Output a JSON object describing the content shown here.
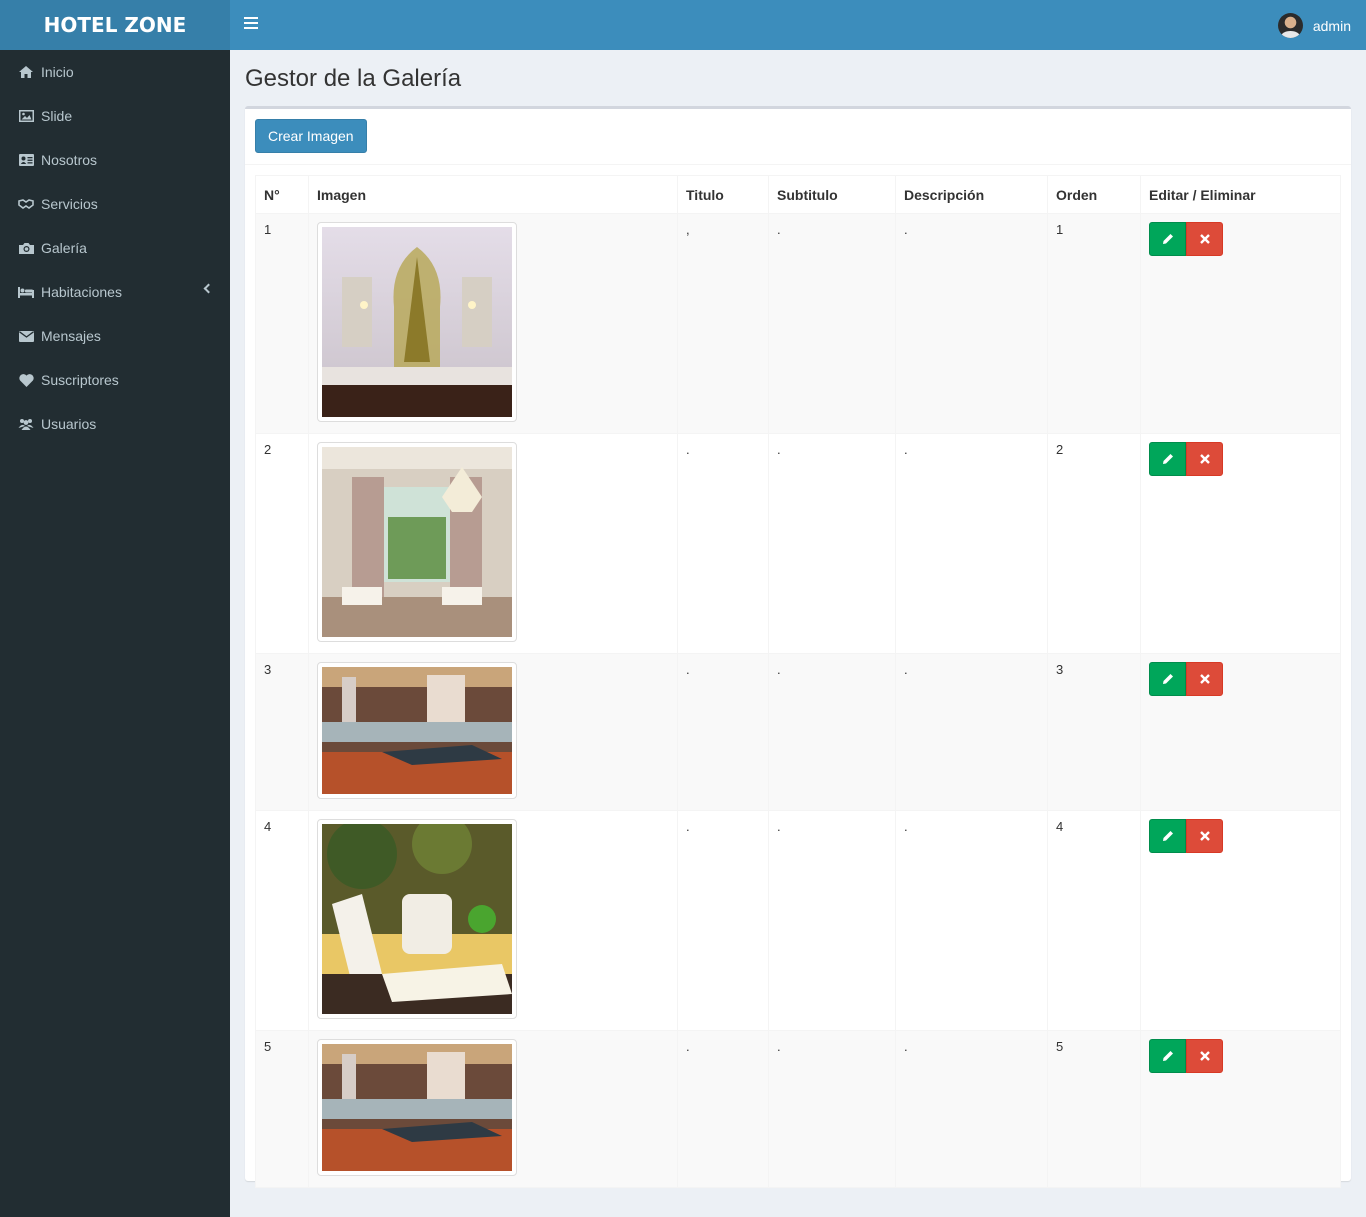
{
  "app": {
    "brand": "HOTEL ZONE"
  },
  "header": {
    "user_name": "admin"
  },
  "sidebar": {
    "items": [
      {
        "label": "Inicio",
        "icon": "home-icon"
      },
      {
        "label": "Slide",
        "icon": "image-icon"
      },
      {
        "label": "Nosotros",
        "icon": "id-card-icon"
      },
      {
        "label": "Servicios",
        "icon": "handshake-icon"
      },
      {
        "label": "Galería",
        "icon": "camera-icon"
      },
      {
        "label": "Habitaciones",
        "icon": "bed-icon"
      },
      {
        "label": "Mensajes",
        "icon": "envelope-icon"
      },
      {
        "label": "Suscriptores",
        "icon": "heart-icon"
      },
      {
        "label": "Usuarios",
        "icon": "users-icon"
      }
    ]
  },
  "main": {
    "title": "Gestor de la Galería",
    "create_button": "Crear Imagen",
    "columns": [
      "N°",
      "Imagen",
      "Titulo",
      "Subtitulo",
      "Descripción",
      "Orden",
      "Editar / Eliminar"
    ],
    "rows": [
      {
        "n": "1",
        "titulo": ",",
        "subtitulo": ".",
        "descripcion": ".",
        "orden": "1"
      },
      {
        "n": "2",
        "titulo": ".",
        "subtitulo": ".",
        "descripcion": ".",
        "orden": "2"
      },
      {
        "n": "3",
        "titulo": ".",
        "subtitulo": ".",
        "descripcion": ".",
        "orden": "3"
      },
      {
        "n": "4",
        "titulo": ".",
        "subtitulo": ".",
        "descripcion": ".",
        "orden": "4"
      },
      {
        "n": "5",
        "titulo": ".",
        "subtitulo": ".",
        "descripcion": ".",
        "orden": "5"
      }
    ]
  },
  "colors": {
    "header": "#3c8dbc",
    "logo_bg": "#367fa9",
    "sidebar": "#222d32",
    "edit": "#00a65a",
    "delete": "#dd4b39"
  }
}
